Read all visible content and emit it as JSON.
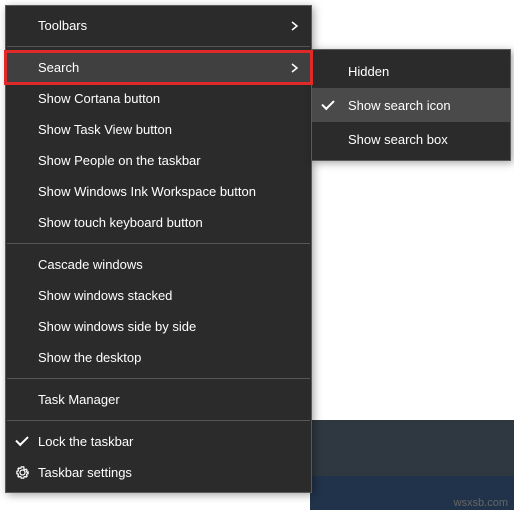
{
  "menu": {
    "toolbars": "Toolbars",
    "search": "Search",
    "cortana": "Show Cortana button",
    "taskview": "Show Task View button",
    "people": "Show People on the taskbar",
    "ink": "Show Windows Ink Workspace button",
    "touchkb": "Show touch keyboard button",
    "cascade": "Cascade windows",
    "stacked": "Show windows stacked",
    "sidebyside": "Show windows side by side",
    "showdesktop": "Show the desktop",
    "taskmgr": "Task Manager",
    "lock": "Lock the taskbar",
    "settings": "Taskbar settings"
  },
  "submenu": {
    "hidden": "Hidden",
    "icon": "Show search icon",
    "box": "Show search box"
  },
  "watermark": "wsxsb.com"
}
